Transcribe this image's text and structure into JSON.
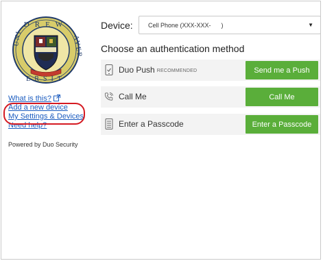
{
  "seal": {
    "letters_top": "DREW",
    "letters_side_left": "UNI",
    "letters_side_right": "AVER",
    "letters_bottom": "ERSIT"
  },
  "links": {
    "what_is_this": "What is this?",
    "add_device": "Add a new device",
    "my_settings": "My Settings & Devices",
    "need_help": "Need help?"
  },
  "powered_by": "Powered by Duo Security",
  "device": {
    "label": "Device:",
    "selected": "Cell Phone (XXX-XXX-      )"
  },
  "choose_title": "Choose an authentication method",
  "methods": [
    {
      "label": "Duo Push",
      "badge": "RECOMMENDED",
      "icon": "phone-check-icon",
      "button": "Send me a Push"
    },
    {
      "label": "Call Me",
      "badge": "",
      "icon": "phone-ring-icon",
      "button": "Call Me"
    },
    {
      "label": "Enter a Passcode",
      "badge": "",
      "icon": "keypad-icon",
      "button": "Enter a Passcode"
    }
  ],
  "colors": {
    "button_green": "#5aae3a",
    "link_blue": "#1a5bbf",
    "highlight_red": "#d51921",
    "row_bg": "#f3f3f3"
  }
}
